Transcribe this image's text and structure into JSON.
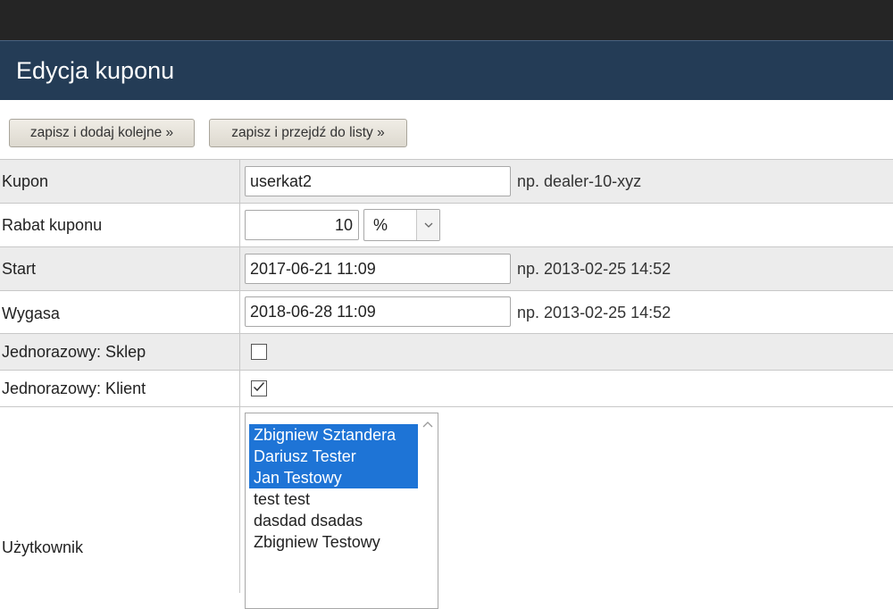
{
  "header": {
    "title": "Edycja kuponu"
  },
  "toolbar": {
    "save_add_label": "zapisz i dodaj kolejne »",
    "save_list_label": "zapisz i przejdź do listy »"
  },
  "form": {
    "kupon": {
      "label": "Kupon",
      "value": "userkat2",
      "hint": "np. dealer-10-xyz"
    },
    "rabat": {
      "label": "Rabat kuponu",
      "value": "10",
      "unit": "%"
    },
    "start": {
      "label": "Start",
      "value": "2017-06-21 11:09",
      "hint": "np. 2013-02-25 14:52"
    },
    "wygasa": {
      "label": "Wygasa",
      "value": "2018-06-28 11:09",
      "hint": "np. 2013-02-25 14:52"
    },
    "jednorazowy_sklep": {
      "label": "Jednorazowy: Sklep",
      "checked": false
    },
    "jednorazowy_klient": {
      "label": "Jednorazowy: Klient",
      "checked": true
    },
    "uzytkownik": {
      "label": "Użytkownik",
      "options": [
        {
          "text": "Zbigniew Sztandera",
          "selected": true
        },
        {
          "text": "Dariusz Tester",
          "selected": true
        },
        {
          "text": "Jan Testowy",
          "selected": true
        },
        {
          "text": "test test",
          "selected": false
        },
        {
          "text": "dasdad dsadas",
          "selected": false
        },
        {
          "text": "Zbigniew Testowy",
          "selected": false
        }
      ]
    }
  },
  "icons": {
    "select_arrow": "chevron-down-icon",
    "checkmark": "check-icon",
    "scroll_up": "chevron-up-icon"
  },
  "colors": {
    "header_bg": "#243c56",
    "topbar_bg": "#252525",
    "selection": "#1e74d6",
    "row_gray": "#ececec"
  }
}
